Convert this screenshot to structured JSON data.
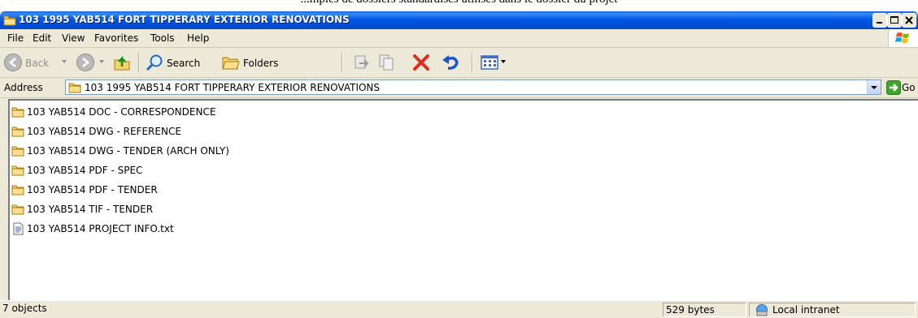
{
  "caption": "...mples de dossiers standardisés utilisés dans le dossier du projet",
  "window": {
    "title": "103 1995 YAB514 FORT TIPPERARY EXTERIOR RENOVATIONS",
    "title_icon": "folder-icon"
  },
  "menu": {
    "items": [
      "File",
      "Edit",
      "View",
      "Favorites",
      "Tools",
      "Help"
    ]
  },
  "toolbar": {
    "back_label": "Back",
    "search_label": "Search",
    "folders_label": "Folders"
  },
  "address": {
    "label": "Address",
    "value": "103 1995 YAB514 FORT TIPPERARY EXTERIOR RENOVATIONS",
    "go_label": "Go"
  },
  "files": [
    {
      "name": "103 YAB514 DOC - CORRESPONDENCE",
      "icon": "folder-icon"
    },
    {
      "name": "103 YAB514 DWG - REFERENCE",
      "icon": "folder-icon"
    },
    {
      "name": "103 YAB514 DWG - TENDER (ARCH ONLY)",
      "icon": "folder-icon"
    },
    {
      "name": "103 YAB514 PDF - SPEC",
      "icon": "folder-icon"
    },
    {
      "name": "103 YAB514 PDF - TENDER",
      "icon": "folder-icon"
    },
    {
      "name": "103 YAB514 TIF - TENDER",
      "icon": "folder-icon"
    },
    {
      "name": "103 YAB514 PROJECT INFO.txt",
      "icon": "text-file-icon"
    }
  ],
  "status": {
    "objects": "7 objects",
    "size": "529 bytes",
    "zone": "Local intranet"
  },
  "colors": {
    "titlebar": "#0054e3",
    "chrome": "#ece9d8",
    "close": "#e04343"
  }
}
